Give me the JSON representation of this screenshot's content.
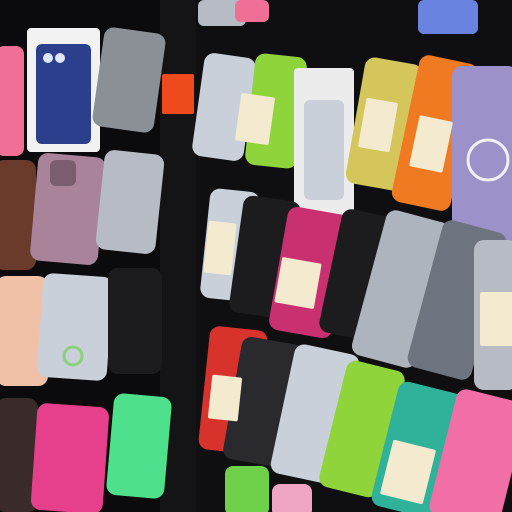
{
  "scene": {
    "subject": "phone-case-display-wall",
    "colors": {
      "background": "#0b0b0d",
      "pillar": "#141416",
      "pink": "#ef6f97",
      "hot_pink": "#e63f8c",
      "magenta": "#c8306f",
      "mint": "#4fe08c",
      "lime": "#8fd43a",
      "navy": "#2b3f8c",
      "mauve": "#a9839a",
      "peach": "#f0c1a6",
      "red": "#d8322c",
      "orange": "#ef7a22",
      "teal": "#2fb19a",
      "black": "#1c1c1f",
      "clear": "#c9d0da",
      "grey": "#8b8f96",
      "label_orange": "#ef4a1c"
    }
  }
}
